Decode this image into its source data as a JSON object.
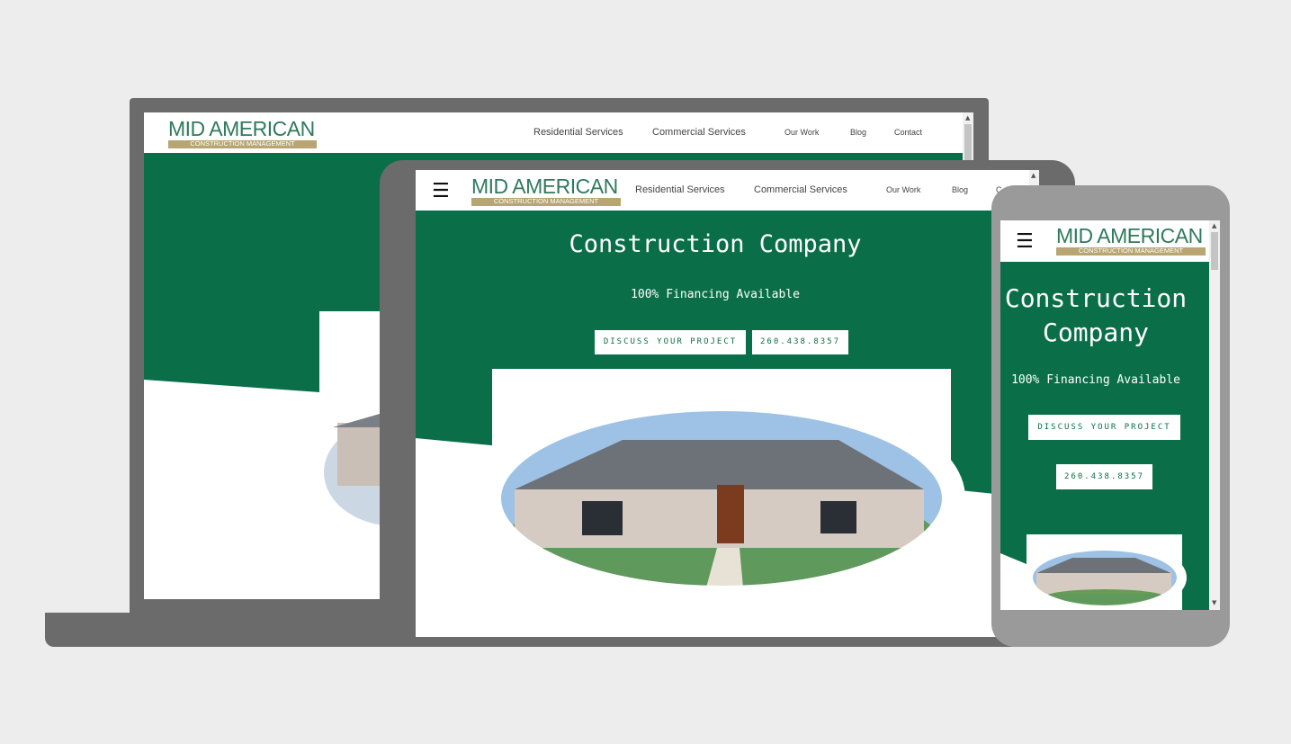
{
  "colors": {
    "brand_green": "#0a6f48",
    "logo_green": "#2f7a5e",
    "logo_tan": "#b7a572",
    "device_gray": "#6b6b6b",
    "phone_gray": "#9a9a9a"
  },
  "brand": {
    "name": "MID AMERICAN",
    "tagline": "CONSTRUCTION MANAGEMENT"
  },
  "nav": {
    "residential": "Residential Services",
    "commercial": "Commercial Services",
    "our_work": "Our Work",
    "blog": "Blog",
    "contact": "Contact",
    "contact_cut": "C"
  },
  "hero": {
    "title": "Construction Company",
    "title_line1": "Construction",
    "title_line2": "Company",
    "subtitle": "100% Financing Available"
  },
  "buttons": {
    "discuss": "DISCUSS YOUR PROJECT",
    "phone": "260.438.8357"
  },
  "icons": {
    "menu": "hamburger-menu-icon",
    "scroll_up": "scroll-up-arrow-icon",
    "scroll_down": "scroll-down-arrow-icon"
  }
}
